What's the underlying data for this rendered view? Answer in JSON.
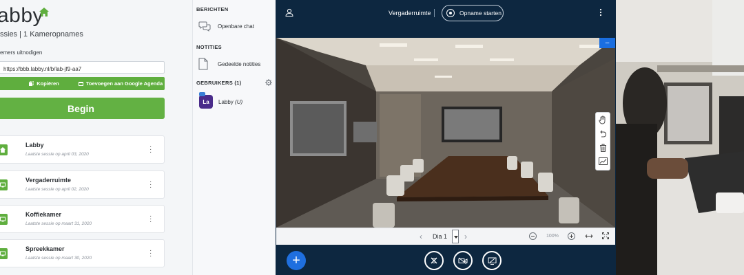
{
  "dashboard": {
    "brand": "abby",
    "subtitle": "ssies | 1 Kameropnames",
    "invite_label": "emers uitnodigen",
    "invite_url": "https://bbb.labby.nl/b/lab-jf9-aa7",
    "copy_label": "Kopiëren",
    "calendar_label": "Toevoegen aan Google Agenda",
    "begin_label": "Begin",
    "rooms": [
      {
        "name": "Labby",
        "sub": "Laatste sessie op april 03, 2020",
        "icon": "home-icon"
      },
      {
        "name": "Vergaderruimte",
        "sub": "Laatste sessie op april 02, 2020",
        "icon": "room-icon"
      },
      {
        "name": "Koffiekamer",
        "sub": "Laatste sessie op maart 31, 2020",
        "icon": "room-icon"
      },
      {
        "name": "Spreekkamer",
        "sub": "Laatste sessie op maart 30, 2020",
        "icon": "room-icon"
      }
    ],
    "accent": "#5fae3e"
  },
  "side_panel": {
    "messages_head": "BERICHTEN",
    "public_chat": "Openbare chat",
    "notes_head": "NOTITIES",
    "shared_notes": "Gedeelde notities",
    "users_head": "GEBRUIKERS (1)",
    "user": {
      "initials": "La",
      "name": "Labby",
      "suffix": "(U)"
    }
  },
  "meeting": {
    "room_title": "Vergaderruimte",
    "record_label": "Opname starten",
    "slide_label": "Dia 1",
    "zoom": "100%",
    "bg": "#0d2740",
    "fab_color": "#1f6fdf"
  }
}
